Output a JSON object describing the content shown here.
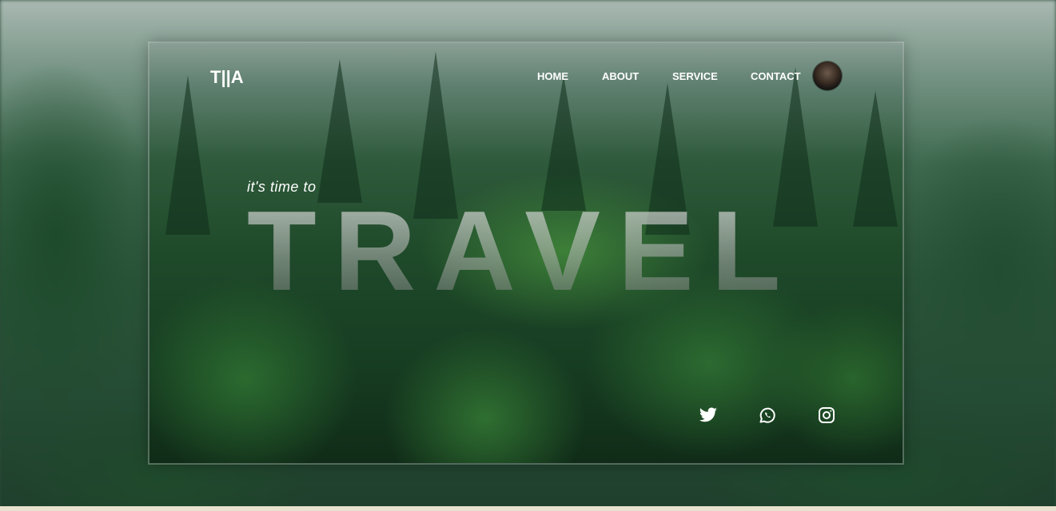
{
  "brand": {
    "logo": "T||A"
  },
  "nav": {
    "items": [
      {
        "label": "HOME"
      },
      {
        "label": "ABOUT"
      },
      {
        "label": "SERVICE"
      },
      {
        "label": "CONTACT"
      }
    ]
  },
  "hero": {
    "tagline": "it's time to",
    "headline": "TRAVEL"
  },
  "social": [
    {
      "icon": "twitter-icon"
    },
    {
      "icon": "whatsapp-icon"
    },
    {
      "icon": "instagram-icon"
    }
  ],
  "colors": {
    "text": "#ffffff",
    "forest_dark": "#173d22",
    "forest_mid": "#2f5a3b",
    "fog": "#a9b9b2"
  }
}
